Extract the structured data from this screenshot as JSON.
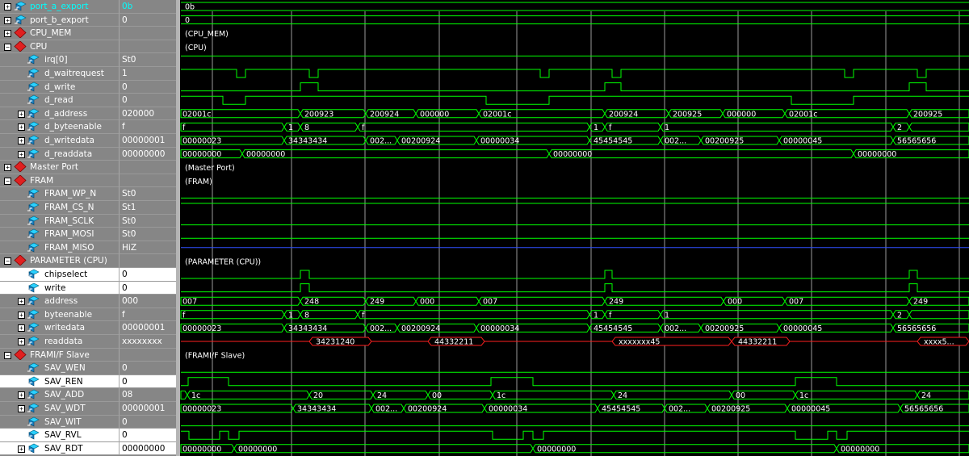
{
  "signals": [
    {
      "name": "port_a_export",
      "value": "0b",
      "icon": "port-icon",
      "expand": "+",
      "indent": 0,
      "first": true
    },
    {
      "name": "port_b_export",
      "value": "0",
      "icon": "port-icon",
      "expand": "+",
      "indent": 0
    },
    {
      "name": "CPU_MEM",
      "value": "",
      "icon": "diamond-icon",
      "expand": "+",
      "indent": 0
    },
    {
      "name": "CPU",
      "value": "",
      "icon": "diamond-icon",
      "expand": "-",
      "indent": 0
    },
    {
      "name": "irq[0]",
      "value": "St0",
      "icon": "signal-icon",
      "expand": "",
      "indent": 1
    },
    {
      "name": "d_waitrequest",
      "value": "1",
      "icon": "signal-icon",
      "expand": "",
      "indent": 1
    },
    {
      "name": "d_write",
      "value": "0",
      "icon": "signal-icon",
      "expand": "",
      "indent": 1
    },
    {
      "name": "d_read",
      "value": "0",
      "icon": "signal-icon",
      "expand": "",
      "indent": 1
    },
    {
      "name": "d_address",
      "value": "020000",
      "icon": "signal-icon",
      "expand": "+",
      "indent": 1
    },
    {
      "name": "d_byteenable",
      "value": "f",
      "icon": "signal-icon",
      "expand": "+",
      "indent": 1
    },
    {
      "name": "d_writedata",
      "value": "00000001",
      "icon": "signal-icon",
      "expand": "+",
      "indent": 1
    },
    {
      "name": "d_readdata",
      "value": "00000000",
      "icon": "signal-icon",
      "expand": "+",
      "indent": 1
    },
    {
      "name": "Master Port",
      "value": "",
      "icon": "diamond-icon",
      "expand": "+",
      "indent": 0
    },
    {
      "name": "FRAM",
      "value": "",
      "icon": "diamond-icon",
      "expand": "-",
      "indent": 0
    },
    {
      "name": "FRAM_WP_N",
      "value": "St0",
      "icon": "signal-icon",
      "expand": "",
      "indent": 1
    },
    {
      "name": "FRAM_CS_N",
      "value": "St1",
      "icon": "signal-icon",
      "expand": "",
      "indent": 1
    },
    {
      "name": "FRAM_SCLK",
      "value": "St0",
      "icon": "signal-icon",
      "expand": "",
      "indent": 1
    },
    {
      "name": "FRAM_MOSI",
      "value": "St0",
      "icon": "signal-icon",
      "expand": "",
      "indent": 1
    },
    {
      "name": "FRAM_MISO",
      "value": "HiZ",
      "icon": "signal-icon",
      "expand": "",
      "indent": 1
    },
    {
      "name": "PARAMETER (CPU)",
      "value": "",
      "icon": "diamond-icon",
      "expand": "-",
      "indent": 0
    },
    {
      "name": "chipselect",
      "value": "0",
      "icon": "signal-icon",
      "expand": "",
      "indent": 1,
      "sel": true
    },
    {
      "name": "write",
      "value": "0",
      "icon": "signal-icon",
      "expand": "",
      "indent": 1,
      "sel": true
    },
    {
      "name": "address",
      "value": "000",
      "icon": "signal-icon",
      "expand": "+",
      "indent": 1
    },
    {
      "name": "byteenable",
      "value": "f",
      "icon": "signal-icon",
      "expand": "+",
      "indent": 1
    },
    {
      "name": "writedata",
      "value": "00000001",
      "icon": "signal-icon",
      "expand": "+",
      "indent": 1
    },
    {
      "name": "readdata",
      "value": "xxxxxxxx",
      "icon": "signal-icon",
      "expand": "+",
      "indent": 1
    },
    {
      "name": "FRAMI/F Slave",
      "value": "",
      "icon": "diamond-icon",
      "expand": "-",
      "indent": 0
    },
    {
      "name": "SAV_WEN",
      "value": "0",
      "icon": "signal-icon",
      "expand": "",
      "indent": 1
    },
    {
      "name": "SAV_REN",
      "value": "0",
      "icon": "signal-icon",
      "expand": "",
      "indent": 1,
      "sel": true
    },
    {
      "name": "SAV_ADD",
      "value": "08",
      "icon": "signal-icon",
      "expand": "+",
      "indent": 1
    },
    {
      "name": "SAV_WDT",
      "value": "00000001",
      "icon": "signal-icon",
      "expand": "+",
      "indent": 1
    },
    {
      "name": "SAV_WIT",
      "value": "0",
      "icon": "signal-icon",
      "expand": "",
      "indent": 1
    },
    {
      "name": "SAV_RVL",
      "value": "0",
      "icon": "signal-icon",
      "expand": "",
      "indent": 1,
      "sel": true
    },
    {
      "name": "SAV_RDT",
      "value": "00000000",
      "icon": "signal-icon",
      "expand": "+",
      "indent": 1,
      "sel": true
    }
  ],
  "group_labels": [
    {
      "row": 2,
      "text": "(CPU_MEM)"
    },
    {
      "row": 3,
      "text": "(CPU)"
    },
    {
      "row": 12,
      "text": "(Master Port)"
    },
    {
      "row": 13,
      "text": "(FRAM)"
    },
    {
      "row": 19,
      "text": "(PARAMETER (CPU))"
    },
    {
      "row": 26,
      "text": "(FRAMI/F Slave)"
    }
  ],
  "waves": {
    "0": {
      "type": "const",
      "label": "0b",
      "color": "#00ff00"
    },
    "1": {
      "type": "const",
      "label": "0",
      "color": "#00ff00"
    },
    "4": {
      "type": "digital",
      "color": "#00ff00",
      "init": 1,
      "edges": []
    },
    "5": {
      "type": "digital",
      "color": "#00ff00",
      "init": 1,
      "edges": [
        293,
        304,
        383,
        394,
        669,
        680,
        758,
        769,
        1046,
        1057,
        1136,
        1147
      ]
    },
    "6": {
      "type": "digital",
      "color": "#00ff00",
      "init": 0,
      "edges": [
        372,
        394,
        749,
        769,
        1126,
        1147
      ]
    },
    "7": {
      "type": "digital",
      "color": "#00ff00",
      "init": 1,
      "edges": [
        276,
        304,
        602,
        680,
        980,
        1057
      ]
    },
    "8": {
      "type": "bus",
      "color": "#00ff00",
      "transitions": [
        372,
        453,
        515,
        593,
        749,
        828,
        895,
        972,
        1126
      ],
      "labels": [
        "02001c",
        "200923",
        "200924",
        "000000",
        "02001c",
        "200924",
        "200925",
        "000000",
        "02001c",
        "200925"
      ]
    },
    "9": {
      "type": "bus",
      "color": "#00ff00",
      "transitions": [
        352,
        372,
        443,
        730,
        749,
        818,
        1106,
        1126
      ],
      "labels": [
        "f",
        "1",
        "8",
        "f",
        "1",
        "f",
        "1",
        "2"
      ]
    },
    "10": {
      "type": "bus",
      "color": "#00ff00",
      "transitions": [
        352,
        453,
        492,
        590,
        730,
        818,
        868,
        965,
        1106
      ],
      "labels": [
        "00000023",
        "34343434",
        "002...",
        "00200924",
        "00000034",
        "45454545",
        "002...",
        "00200925",
        "00000045",
        "56565656"
      ]
    },
    "11": {
      "type": "bus",
      "color": "#00ff00",
      "transitions": [
        300,
        680,
        1057
      ],
      "labels": [
        "00000000",
        "00000000",
        "00000000",
        "00000000"
      ]
    },
    "14": {
      "type": "digital",
      "color": "#00ff00",
      "init": 0,
      "edges": []
    },
    "15": {
      "type": "digital",
      "color": "#00ff00",
      "init": 1,
      "edges": []
    },
    "16": {
      "type": "digital",
      "color": "#00ff00",
      "init": 0,
      "edges": []
    },
    "17": {
      "type": "digital",
      "color": "#00ff00",
      "init": 0,
      "edges": []
    },
    "18": {
      "type": "hiz",
      "color": "#3050ff"
    },
    "20": {
      "type": "digital",
      "color": "#00ff00",
      "init": 0,
      "edges": [
        372,
        383,
        749,
        758,
        1126,
        1136
      ]
    },
    "21": {
      "type": "digital",
      "color": "#00ff00",
      "init": 0,
      "edges": [
        372,
        383,
        749,
        758,
        1126,
        1136
      ]
    },
    "22": {
      "type": "bus",
      "color": "#00ff00",
      "transitions": [
        372,
        453,
        515,
        593,
        749,
        896,
        972,
        1126
      ],
      "labels": [
        "007",
        "248",
        "249",
        "000",
        "007",
        "249",
        "000",
        "007",
        "249"
      ]
    },
    "23": {
      "type": "bus",
      "color": "#00ff00",
      "transitions": [
        352,
        372,
        443,
        730,
        749,
        818,
        1106,
        1126
      ],
      "labels": [
        "f",
        "1",
        "8",
        "f",
        "1",
        "f",
        "1",
        "2"
      ]
    },
    "24": {
      "type": "bus",
      "color": "#00ff00",
      "transitions": [
        352,
        453,
        492,
        590,
        730,
        818,
        868,
        965,
        1106
      ],
      "labels": [
        "00000023",
        "34343434",
        "002...",
        "00200924",
        "00000034",
        "45454545",
        "002...",
        "00200925",
        "00000045",
        "56565656"
      ]
    },
    "25": {
      "type": "redbus",
      "color": "#ff2020",
      "segments": [
        [
          383,
          460,
          "34231240"
        ],
        [
          530,
          600,
          "44332211"
        ],
        [
          758,
          906,
          "xxxxxxx45"
        ],
        [
          906,
          978,
          "44332211"
        ],
        [
          1136,
          1200,
          "xxxx5..."
        ]
      ]
    },
    "27": {
      "type": "digital",
      "color": "#00ff00",
      "init": 0,
      "edges": []
    },
    "28": {
      "type": "digital",
      "color": "#00ff00",
      "init": 0,
      "edges": [
        233,
        283,
        608,
        660,
        985,
        1036
      ]
    },
    "29": {
      "type": "bus",
      "color": "#00ff00",
      "transitions": [
        232,
        383,
        462,
        530,
        610,
        760,
        906,
        985,
        1136
      ],
      "labels": [
        "",
        "1c",
        "20",
        "24",
        "00",
        "1c",
        "24",
        "00",
        "1c",
        "24"
      ]
    },
    "30": {
      "type": "bus",
      "color": "#00ff00",
      "transitions": [
        363,
        460,
        500,
        600,
        740,
        823,
        876,
        975,
        1115
      ],
      "labels": [
        "00000023",
        "34343434",
        "002...",
        "00200924",
        "00000034",
        "45454545",
        "002...",
        "00200925",
        "00000045",
        "56565656"
      ]
    },
    "31": {
      "type": "digital",
      "color": "#00ff00",
      "init": 0,
      "edges": []
    },
    "32": {
      "type": "digital",
      "color": "#00ff00",
      "init": 1,
      "edges": [
        234,
        272,
        283,
        296,
        610,
        648,
        660,
        673,
        985,
        1025,
        1036,
        1049
      ]
    },
    "33": {
      "type": "bus",
      "color": "#00ff00",
      "transitions": [
        290,
        660,
        1036
      ],
      "labels": [
        "00000000",
        "00000000",
        "00000000",
        "00000000"
      ]
    }
  },
  "colors": {
    "wave": "#00ff00",
    "grid": "#9a9a9a",
    "hiz": "#3050ff",
    "xval": "#ff2020",
    "panel": "#868686",
    "selected": "#ffffff"
  }
}
